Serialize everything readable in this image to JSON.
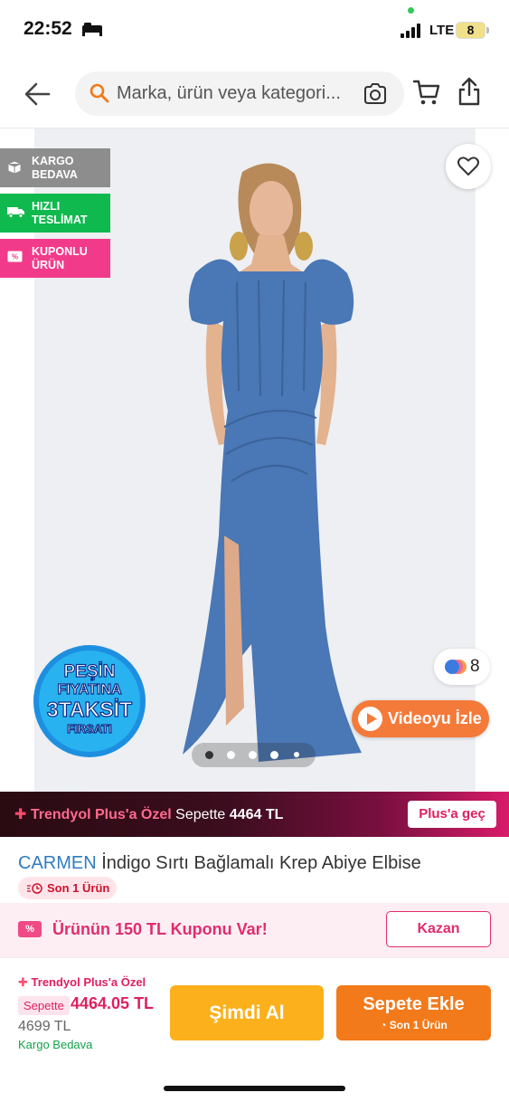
{
  "status_bar": {
    "time": "22:52",
    "network": "LTE",
    "battery": "8"
  },
  "header": {
    "search_placeholder": "Marka, ürün veya kategori...",
    "icons": [
      "back-arrow-icon",
      "search-icon",
      "camera-icon",
      "cart-icon",
      "share-icon"
    ]
  },
  "gallery": {
    "badges": [
      {
        "label": "KARGO BEDAVA",
        "color": "#8d8d8d"
      },
      {
        "label": "HIZLI TESLİMAT",
        "color": "#10b94e"
      },
      {
        "label": "KUPONLU ÜRÜN",
        "color": "#f23a8b"
      }
    ],
    "promo_lines": [
      "PEŞİN",
      "FIYATINA",
      "3TAKSİT",
      "FIRSATI"
    ],
    "color_count": "8",
    "video_label": "Videoyu İzle",
    "page_count": 5,
    "active_page": 1
  },
  "plus_strip": {
    "label": "Trendyol Plus'a Özel",
    "sepette": "Sepette",
    "price": "4464 TL",
    "button": "Plus'a geç"
  },
  "product": {
    "brand": "CARMEN",
    "name": "İndigo Sırtı Bağlamalı Krep Abiye Elbise",
    "stock": "Son 1 Ürün"
  },
  "coupon": {
    "text": "Ürünün 150 TL Kuponu Var!",
    "button": "Kazan"
  },
  "bottom_bar": {
    "plus_label": "Trendyol Plus'a Özel",
    "sepette_tag": "Sepette",
    "sepette_price": "4464.05 TL",
    "price": "4699 TL",
    "shipping": "Kargo Bedava",
    "buy_now": "Şimdi Al",
    "add_to_cart": "Sepete Ekle",
    "add_to_cart_sub": "Son 1 Ürün"
  },
  "colors": {
    "accent": "#f27a1a",
    "buy_now": "#fbb01c",
    "plus_pink": "#e0205f",
    "brand_blue": "#2f7cc2",
    "dress": "#4a77b5"
  }
}
